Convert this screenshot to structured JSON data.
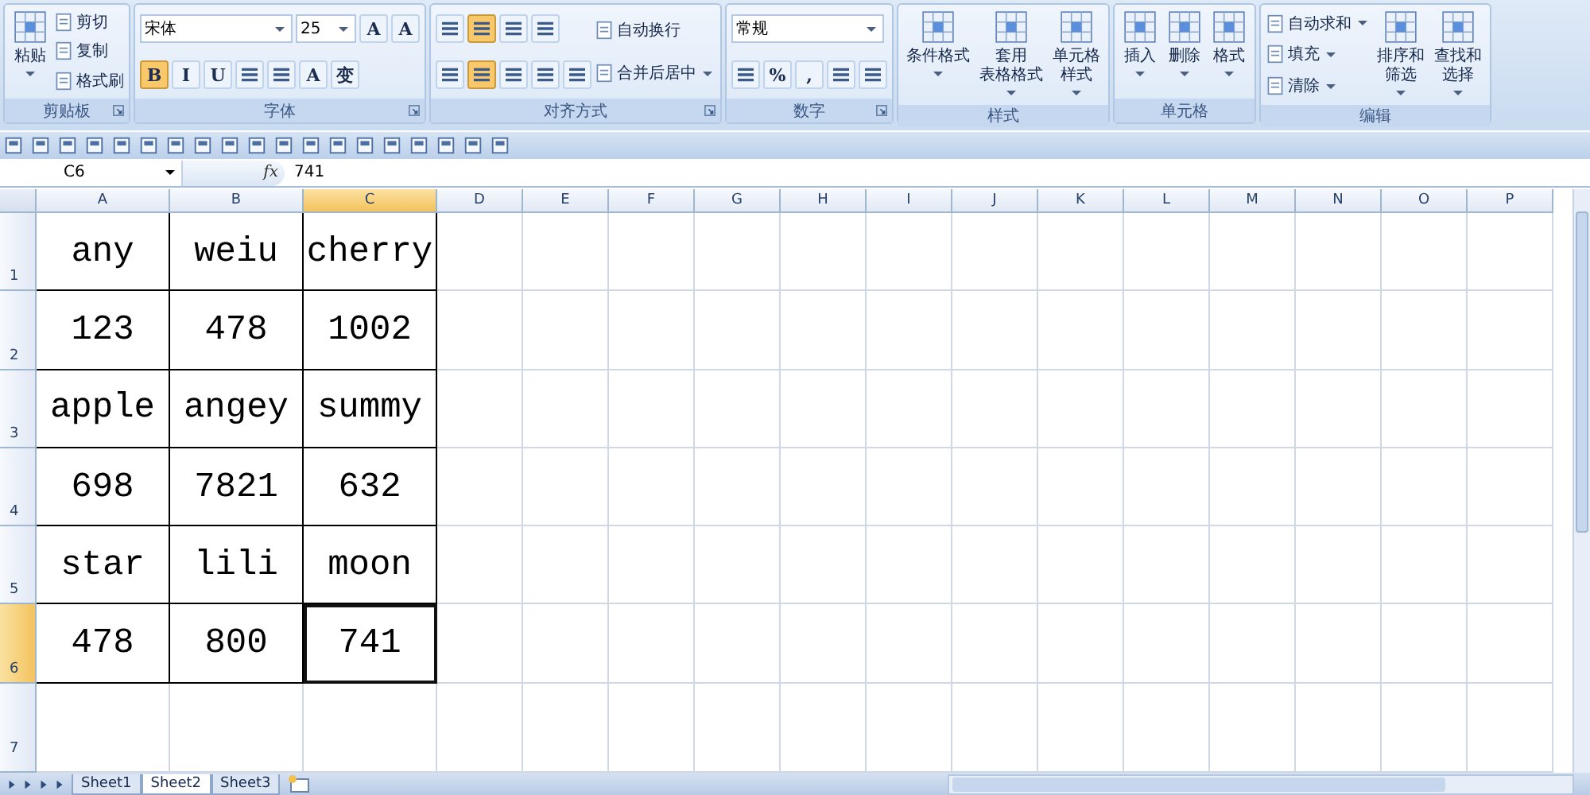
{
  "ribbon": {
    "groups": [
      {
        "label": "剪贴板",
        "launcher": true,
        "sections": [
          {
            "kind": "large",
            "lines": [
              "粘贴"
            ],
            "dropdown": true
          },
          {
            "kind": "stack",
            "items": [
              {
                "label": "剪切",
                "dropdown": false
              },
              {
                "label": "复制",
                "dropdown": false
              },
              {
                "label": "格式刷",
                "dropdown": false
              }
            ]
          }
        ]
      },
      {
        "label": "字体",
        "launcher": true,
        "sections": [
          {
            "kind": "grid",
            "rows": [
              {
                "controls": [
                  {
                    "kind": "combo",
                    "value": "宋体",
                    "wide": true
                  },
                  {
                    "kind": "combo",
                    "value": "25",
                    "wide": false
                  },
                  {
                    "kind": "glyph",
                    "text": "A",
                    "selected": false
                  },
                  {
                    "kind": "glyph",
                    "text": "A",
                    "selected": false
                  }
                ]
              },
              {
                "controls": [
                  {
                    "kind": "glyph",
                    "text": "B",
                    "selected": true
                  },
                  {
                    "kind": "glyph",
                    "text": "I",
                    "selected": false
                  },
                  {
                    "kind": "glyph",
                    "text": "U",
                    "selected": false
                  },
                  {
                    "kind": "icon",
                    "selected": false
                  },
                  {
                    "kind": "icon",
                    "selected": false
                  },
                  {
                    "kind": "glyph",
                    "text": "A",
                    "selected": false
                  },
                  {
                    "kind": "glyph",
                    "text": "变",
                    "selected": false
                  }
                ]
              }
            ]
          }
        ]
      },
      {
        "label": "对齐方式",
        "launcher": true,
        "sections": [
          {
            "kind": "grid",
            "rows": [
              {
                "controls": [
                  {
                    "kind": "icon",
                    "selected": false
                  },
                  {
                    "kind": "icon",
                    "selected": true
                  },
                  {
                    "kind": "icon",
                    "selected": false
                  },
                  {
                    "kind": "icon",
                    "selected": false
                  }
                ]
              },
              {
                "controls": [
                  {
                    "kind": "icon",
                    "selected": false
                  },
                  {
                    "kind": "icon",
                    "selected": true
                  },
                  {
                    "kind": "icon",
                    "selected": false
                  },
                  {
                    "kind": "icon",
                    "selected": false
                  },
                  {
                    "kind": "icon",
                    "selected": false
                  }
                ]
              }
            ]
          },
          {
            "kind": "stack",
            "items": [
              {
                "label": "自动换行",
                "dropdown": false
              },
              {
                "label": "合并后居中",
                "dropdown": true
              }
            ]
          }
        ]
      },
      {
        "label": "数字",
        "launcher": true,
        "sections": [
          {
            "kind": "grid",
            "rows": [
              {
                "controls": [
                  {
                    "kind": "combo",
                    "value": "常规",
                    "wide": true
                  }
                ]
              },
              {
                "controls": [
                  {
                    "kind": "icon",
                    "selected": false
                  },
                  {
                    "kind": "glyph",
                    "text": "%",
                    "selected": false
                  },
                  {
                    "kind": "glyph",
                    "text": ",",
                    "selected": false
                  },
                  {
                    "kind": "icon",
                    "selected": false
                  },
                  {
                    "kind": "icon",
                    "selected": false
                  }
                ]
              }
            ]
          }
        ]
      },
      {
        "label": "样式",
        "launcher": false,
        "sections": [
          {
            "kind": "large",
            "lines": [
              "条件格式"
            ],
            "dropdown": true
          },
          {
            "kind": "large",
            "lines": [
              "套用",
              "表格格式"
            ],
            "dropdown": true
          },
          {
            "kind": "large",
            "lines": [
              "单元格",
              "样式"
            ],
            "dropdown": true
          }
        ]
      },
      {
        "label": "单元格",
        "launcher": false,
        "sections": [
          {
            "kind": "large",
            "lines": [
              "插入"
            ],
            "dropdown": true
          },
          {
            "kind": "large",
            "lines": [
              "删除"
            ],
            "dropdown": true
          },
          {
            "kind": "large",
            "lines": [
              "格式"
            ],
            "dropdown": true
          }
        ]
      },
      {
        "label": "编辑",
        "launcher": false,
        "sections": [
          {
            "kind": "stack",
            "items": [
              {
                "label": "自动求和",
                "dropdown": true
              },
              {
                "label": "填充",
                "dropdown": true
              },
              {
                "label": "清除",
                "dropdown": true
              }
            ]
          },
          {
            "kind": "large",
            "lines": [
              "排序和",
              "筛选"
            ],
            "dropdown": true
          },
          {
            "kind": "large",
            "lines": [
              "查找和",
              "选择"
            ],
            "dropdown": true
          }
        ]
      }
    ]
  },
  "formula_bar": {
    "name_box": "C6",
    "function_symbol": "fx",
    "value": "741"
  },
  "sheet": {
    "columns": [
      {
        "label": "A",
        "selected": false
      },
      {
        "label": "B",
        "selected": false
      },
      {
        "label": "C",
        "selected": true
      },
      {
        "label": "D",
        "selected": false
      },
      {
        "label": "E",
        "selected": false
      },
      {
        "label": "F",
        "selected": false
      },
      {
        "label": "G",
        "selected": false
      },
      {
        "label": "H",
        "selected": false
      },
      {
        "label": "I",
        "selected": false
      },
      {
        "label": "J",
        "selected": false
      },
      {
        "label": "K",
        "selected": false
      },
      {
        "label": "L",
        "selected": false
      },
      {
        "label": "M",
        "selected": false
      },
      {
        "label": "N",
        "selected": false
      },
      {
        "label": "O",
        "selected": false
      },
      {
        "label": "P",
        "selected": false
      }
    ],
    "rows": [
      {
        "label": "1",
        "selected": false,
        "cells": [
          {
            "value": "any",
            "selected": false
          },
          {
            "value": "weiu",
            "selected": false
          },
          {
            "value": "cherry",
            "selected": false
          }
        ]
      },
      {
        "label": "2",
        "selected": false,
        "cells": [
          {
            "value": "123",
            "selected": false
          },
          {
            "value": "478",
            "selected": false
          },
          {
            "value": "1002",
            "selected": false
          }
        ]
      },
      {
        "label": "3",
        "selected": false,
        "cells": [
          {
            "value": "apple",
            "selected": false
          },
          {
            "value": "angey",
            "selected": false
          },
          {
            "value": "summy",
            "selected": false
          }
        ]
      },
      {
        "label": "4",
        "selected": false,
        "cells": [
          {
            "value": "698",
            "selected": false
          },
          {
            "value": "7821",
            "selected": false
          },
          {
            "value": "632",
            "selected": false
          }
        ]
      },
      {
        "label": "5",
        "selected": false,
        "cells": [
          {
            "value": "star",
            "selected": false
          },
          {
            "value": "lili",
            "selected": false
          },
          {
            "value": "moon",
            "selected": false
          }
        ]
      },
      {
        "label": "6",
        "selected": true,
        "cells": [
          {
            "value": "478",
            "selected": false
          },
          {
            "value": "800",
            "selected": false
          },
          {
            "value": "741",
            "selected": true
          }
        ]
      },
      {
        "label": "7",
        "selected": false,
        "cells": []
      }
    ]
  },
  "sheet_tabs": [
    {
      "label": "Sheet1",
      "selected": false
    },
    {
      "label": "Sheet2",
      "selected": true
    },
    {
      "label": "Sheet3",
      "selected": false
    }
  ]
}
